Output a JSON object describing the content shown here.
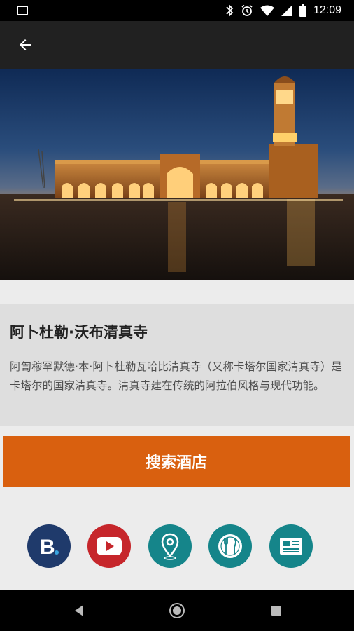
{
  "status_bar": {
    "time": "12:09"
  },
  "attraction": {
    "title": "阿卜杜勒·沃布清真寺",
    "description": "阿訇穆罕默德·本·阿卜杜勒瓦哈比清真寺（又称卡塔尔国家清真寺）是卡塔尔的国家清真寺。清真寺建在传统的阿拉伯风格与现代功能。"
  },
  "search_button": {
    "label": "搜索酒店"
  },
  "quick_links": [
    {
      "icon": "booking-icon",
      "color": "#1f3a6b"
    },
    {
      "icon": "youtube-icon",
      "color": "#c6262b"
    },
    {
      "icon": "map-pin-icon",
      "color": "#15858a"
    },
    {
      "icon": "restaurant-icon",
      "color": "#15858a"
    },
    {
      "icon": "newspaper-icon",
      "color": "#15858a"
    }
  ],
  "colors": {
    "accent": "#d9600f",
    "toolbar": "#212121",
    "teal": "#15858a",
    "navy": "#1f3a6b",
    "red": "#c6262b"
  }
}
